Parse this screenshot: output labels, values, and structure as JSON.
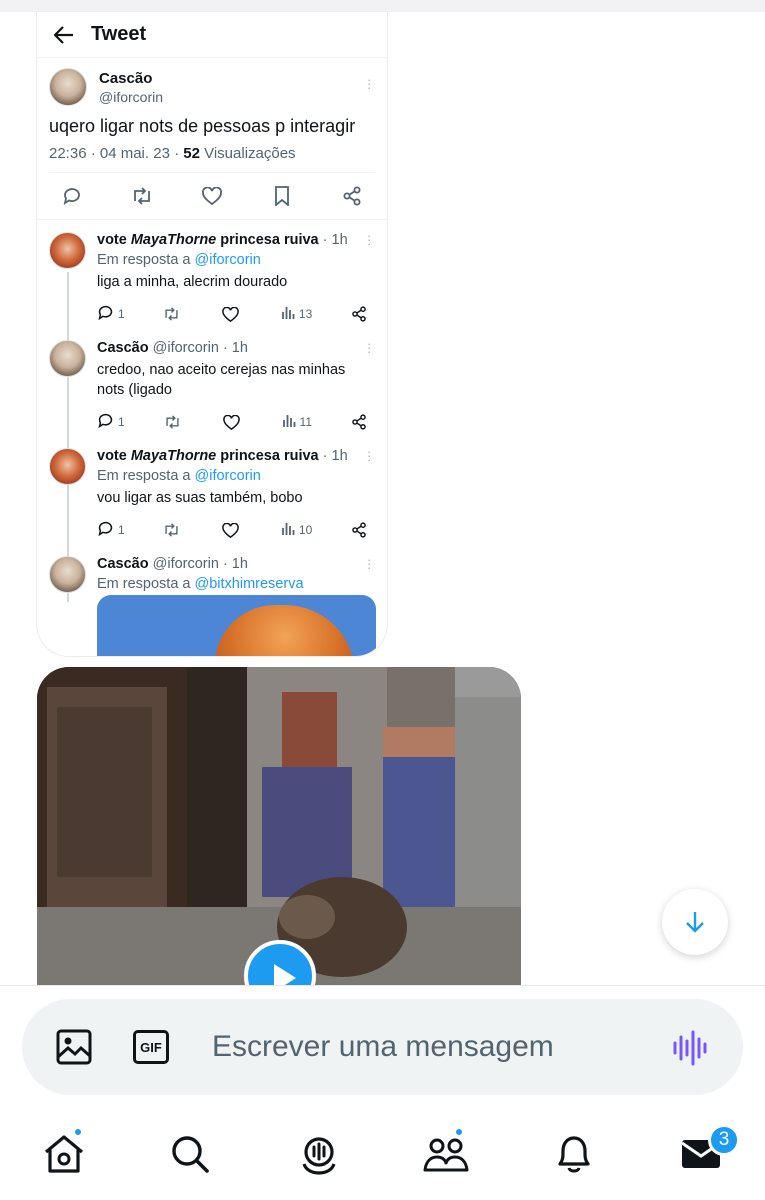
{
  "tweet_card": {
    "header_title": "Tweet",
    "main_tweet": {
      "name": "Cascão",
      "handle": "@iforcorin",
      "text": "uqero ligar nots de pessoas p interagir",
      "time": "22:36 · 04 mai. 23 · ",
      "views_count": "52",
      "views_label": " Visualizações"
    },
    "replies": [
      {
        "name_prefix": "vote ",
        "name_italic": "MayaThorne",
        "name_suffix": " princesa ruiva",
        "time": " · 1h",
        "in_reply_label": "Em resposta a ",
        "in_reply_handle": "@iforcorin",
        "text": "liga a minha, alecrim dourado",
        "reply_count": "1",
        "views": "13"
      },
      {
        "name": "Cascão",
        "handle_time": " @iforcorin · 1h",
        "text": "credoo, nao aceito cerejas nas minhas nots (ligado",
        "reply_count": "1",
        "views": "11"
      },
      {
        "name_prefix": "vote ",
        "name_italic": "MayaThorne",
        "name_suffix": " princesa ruiva",
        "time": " · 1h",
        "in_reply_label": "Em resposta a ",
        "in_reply_handle": "@iforcorin",
        "text": "vou ligar as suas também, bobo",
        "reply_count": "1",
        "views": "10"
      },
      {
        "name": "Cascão",
        "handle_time": " @iforcorin · 1h",
        "in_reply_label": "Em resposta a ",
        "in_reply_handle": "@bitxhimreserva"
      }
    ]
  },
  "composer": {
    "placeholder": "Escrever uma mensagem",
    "gif_label": "GIF"
  },
  "bottom_nav": {
    "messages_badge": "3"
  },
  "colors": {
    "accent": "#1d9bf0",
    "voice": "#7856ff"
  }
}
